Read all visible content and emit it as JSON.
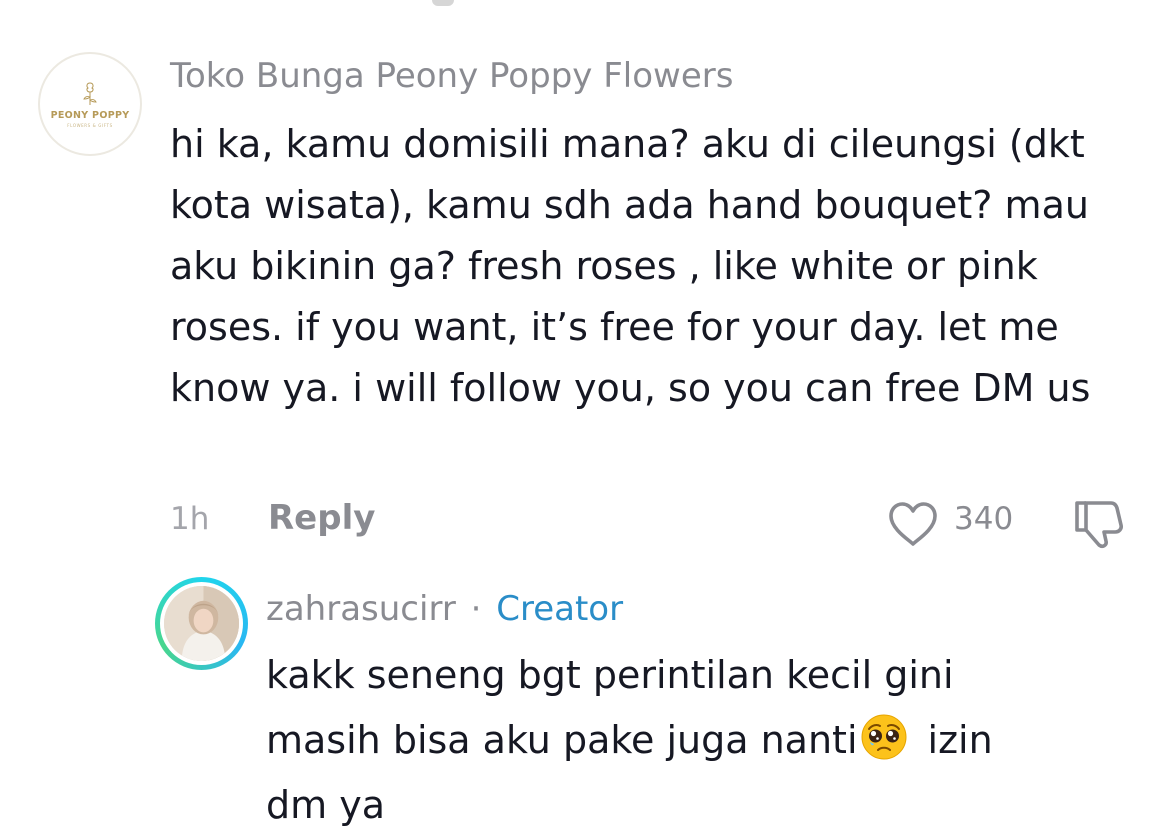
{
  "comments": [
    {
      "username": "Toko Bunga Peony Poppy Flowers",
      "avatar": {
        "icon": "peony-poppy-logo",
        "logo_title": "PEONY POPPY",
        "logo_subtitle": "FLOWERS & GIFTS"
      },
      "text": "hi ka, kamu domisili mana? aku di cileungsi (dkt kota wisata), kamu sdh ada hand bouquet? mau aku bikinin ga? fresh roses , like white or pink roses. if you want, it’s free for your day. let me know ya. i will follow you, so you can free DM us",
      "time": "1h",
      "reply_label": "Reply",
      "like_icon": "heart-outline-icon",
      "likes": "340",
      "dislike_icon": "thumbs-down-icon"
    }
  ],
  "reply": {
    "username": "zahrasucirr",
    "separator": "·",
    "badge": "Creator",
    "avatar_icon": "profile-photo-with-story-ring",
    "text_line1": "kakk seneng bgt perintilan kecil gini",
    "text_line2_before": "masih bisa aku pake juga nanti",
    "emoji": "pleading-face-emoji",
    "text_line2_after": "izin",
    "text_line3": "dm ya"
  },
  "colors": {
    "text": "#161823",
    "secondary": "#8a8b91",
    "creator_badge": "#2a8dc8",
    "story_ring": "#20d5ec"
  }
}
